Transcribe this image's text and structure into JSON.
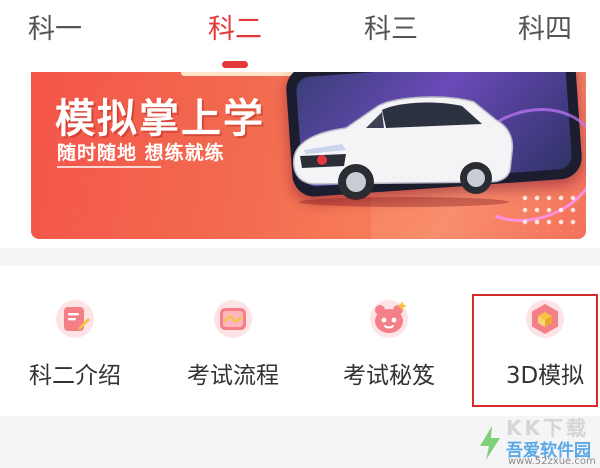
{
  "tabs": [
    {
      "label": "科一",
      "active": false
    },
    {
      "label": "科二",
      "active": true
    },
    {
      "label": "科三",
      "active": false
    },
    {
      "label": "科四",
      "active": false
    }
  ],
  "banner": {
    "title": "模拟掌上学",
    "subtitle": "随时随地  想练就练"
  },
  "shortcuts": [
    {
      "label": "科二介绍",
      "icon": "edit-note-icon"
    },
    {
      "label": "考试流程",
      "icon": "process-card-icon"
    },
    {
      "label": "考试秘笈",
      "icon": "mascot-face-icon"
    },
    {
      "label": "3D模拟",
      "icon": "3d-cube-icon",
      "highlighted": true
    }
  ],
  "watermark": {
    "glyphs": "KK下载",
    "name": "吾爱软件园",
    "url": "www.52zxue.com"
  },
  "colors": {
    "accent": "#e5383b",
    "banner_gradient_start": "#f4554a",
    "banner_gradient_end": "#f36a55",
    "icon_pink": "#f47f86",
    "highlight_border": "#d62b2b"
  }
}
